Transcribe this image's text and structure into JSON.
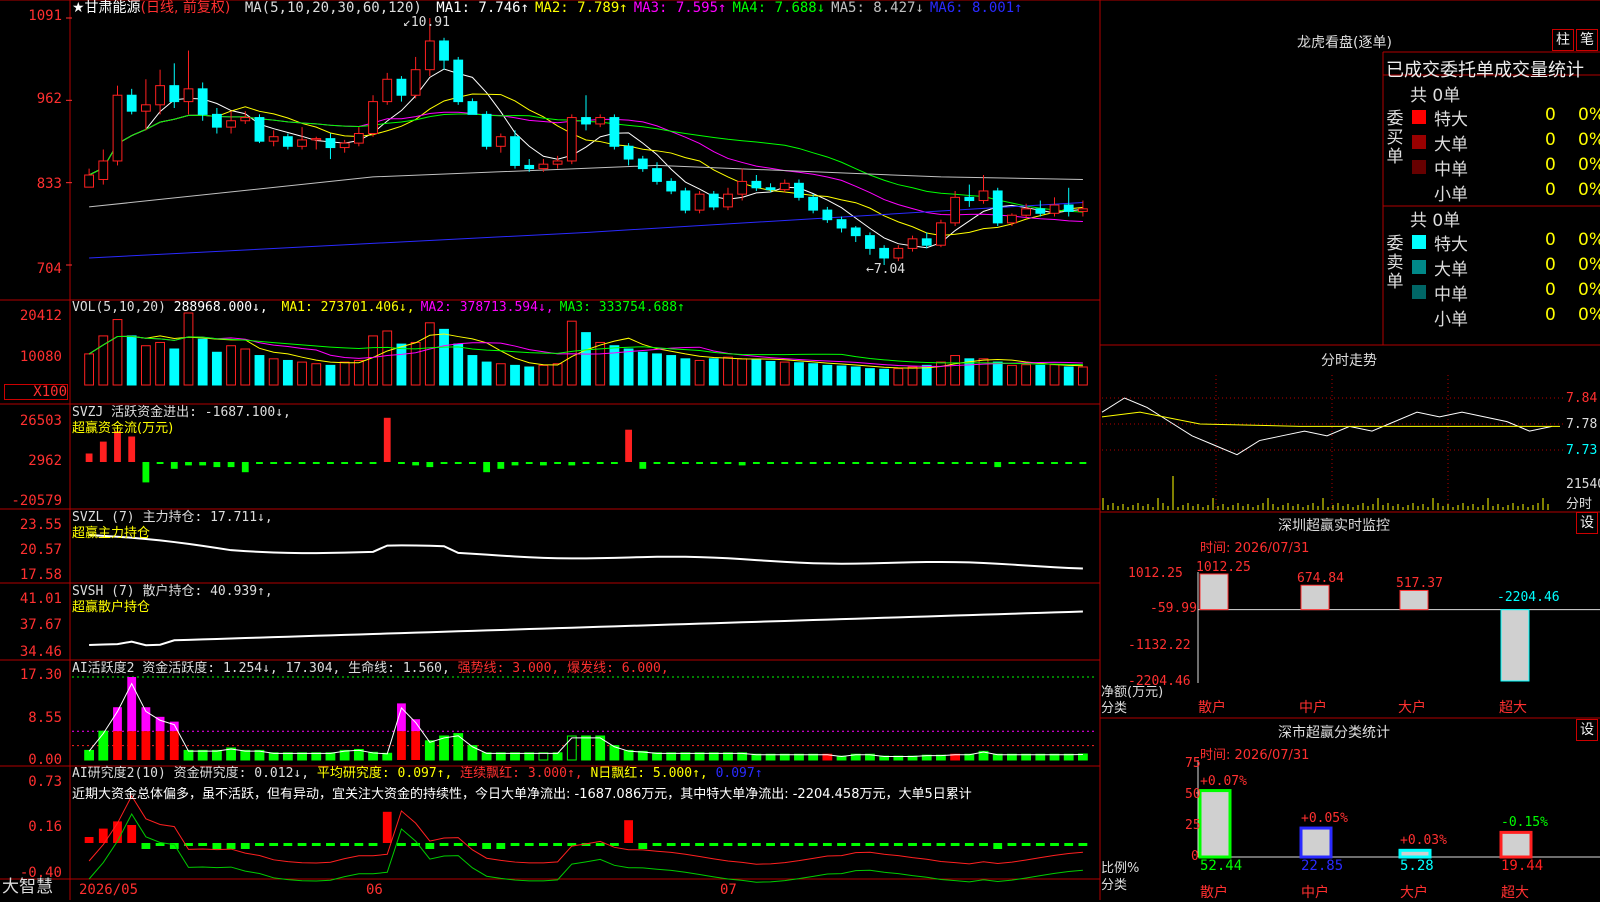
{
  "header": {
    "stock": "★甘肃能源",
    "mode": "(日线, 前复权)",
    "ma_label": "MA(5,10,20,30,60,120)",
    "ma_values": [
      {
        "text": "MA1: 7.746↑",
        "color": "#ffffff"
      },
      {
        "text": "MA2: 7.789↑",
        "color": "#ffff00"
      },
      {
        "text": "MA3: 7.595↑",
        "color": "#ff00ff"
      },
      {
        "text": "MA4: 7.688↓",
        "color": "#00ff00"
      },
      {
        "text": "MA5: 8.427↓",
        "color": "#c0c0c0"
      },
      {
        "text": "MA6: 8.001↑",
        "color": "#2a2aff"
      }
    ],
    "high_mark": "10.91",
    "low_mark": "←7.04"
  },
  "price_axis": [
    "1091",
    "962",
    "833",
    "704"
  ],
  "vol_panel": {
    "title": "VOL(5,10,20)",
    "value": "288968.000↓,",
    "ma": [
      {
        "text": "MA1: 273701.406↓,",
        "color": "#ffff00"
      },
      {
        "text": "MA2: 378713.594↓,",
        "color": "#ff00ff"
      },
      {
        "text": "MA3: 333754.688↑",
        "color": "#00ff00"
      }
    ],
    "axis": [
      "20412",
      "10080",
      "X100"
    ]
  },
  "svzj_panel": {
    "title": "SVZJ  活跃资金进出: -1687.100↓,",
    "subtitle": "超赢资金流(万元)",
    "axis": [
      "26503",
      "2962",
      "-20579"
    ]
  },
  "svzl_panel": {
    "title": "SVZL (7) 主力持仓: 17.711↓,",
    "subtitle": "超赢主力持仓",
    "axis": [
      "23.55",
      "20.57",
      "17.58"
    ]
  },
  "svsh_panel": {
    "title": "SVSH (7) 散户持仓: 40.939↑,",
    "subtitle": "超赢散户持仓",
    "axis": [
      "41.01",
      "37.67",
      "34.46"
    ]
  },
  "active_panel": {
    "title_a": "AI活跃度2 资金活跃度: 1.254↓, 17.304, 生命线: 1.560,",
    "title_b": "强势线: 3.000, 爆发线: 6.000,",
    "axis": [
      "17.30",
      "8.55",
      "0.00"
    ]
  },
  "research_panel": {
    "title_a": "AI研究度2(10) 资金研究度: 0.012↓,",
    "title_b": "平均研究度: 0.097↑,",
    "title_c": "连续飘红: 3.000↑,",
    "title_d": "N日飘红: 5.000↑,",
    "title_e": "0.097↑",
    "comment": "近期大资金总体偏多，虽不活跃，但有异动，宜关注大资金的持续性，今日大单净流出: -1687.086万元，其中特大单净流出: -2204.458万元，大单5日累计",
    "axis": [
      "0.73",
      "0.16",
      "-0.40"
    ]
  },
  "date_axis": [
    "2026/05",
    "06",
    "07"
  ],
  "footer_logo": "大智慧",
  "longhu": {
    "title": "龙虎看盘(逐单)",
    "btn_a": "柱",
    "btn_b": "笔",
    "subtitle": "已成交委托单成交量统计",
    "buy_side": "委买单",
    "sell_side": "委卖单",
    "buy_total": "共 0单",
    "sell_total": "共 0单",
    "buy_rows": [
      {
        "name": "特大",
        "v": "0",
        "p": "0%",
        "color": "#ff0000"
      },
      {
        "name": "大单",
        "v": "0",
        "p": "0%",
        "color": "#990000"
      },
      {
        "name": "中单",
        "v": "0",
        "p": "0%",
        "color": "#660000"
      },
      {
        "name": "小单",
        "v": "0",
        "p": "0%",
        "color": ""
      }
    ],
    "sell_rows": [
      {
        "name": "特大",
        "v": "0",
        "p": "0%",
        "color": "#00ffff"
      },
      {
        "name": "大单",
        "v": "0",
        "p": "0%",
        "color": "#008888"
      },
      {
        "name": "中单",
        "v": "0",
        "p": "0%",
        "color": "#006666"
      },
      {
        "name": "小单",
        "v": "0",
        "p": "0%",
        "color": ""
      }
    ]
  },
  "intraday": {
    "title": "分时走势",
    "axis": [
      "7.84",
      "7.78",
      "7.73"
    ],
    "vol_axis": [
      "21540",
      "分时"
    ]
  },
  "monitor": {
    "title": "深圳超赢实时监控",
    "btn": "设",
    "time": "时间: 2026/07/31",
    "axis": [
      "1012.25",
      "-59.99",
      "-1132.22",
      "-2204.46"
    ],
    "ylabel_a": "净额(万元)",
    "ylabel_b": "分类",
    "categories": [
      "散户",
      "中户",
      "大户",
      "超大"
    ],
    "value_labels": [
      "1012.25",
      "674.84",
      "517.37",
      "-2204.46"
    ]
  },
  "classify": {
    "title": "深市超赢分类统计",
    "btn": "设",
    "time": "时间: 2026/07/31",
    "axis": [
      "75",
      "50",
      "25",
      "0"
    ],
    "ylabel_a": "比例%",
    "ylabel_b": "分类",
    "categories": [
      "散户",
      "中户",
      "大户",
      "超大"
    ],
    "pct_labels": [
      "+0.07%",
      "+0.05%",
      "+0.03%",
      "-0.15%"
    ],
    "share_labels": [
      "52.44",
      "22.85",
      "5.28",
      "19.44"
    ]
  },
  "chart_data": {
    "type": "candlestick",
    "price_ylim": [
      7.04,
      10.91
    ],
    "candles": [
      [
        8.26,
        8.45,
        8.38,
        8.55
      ],
      [
        8.38,
        8.67,
        8.3,
        8.85
      ],
      [
        8.67,
        9.7,
        8.6,
        9.85
      ],
      [
        9.7,
        9.45,
        9.4,
        9.8
      ],
      [
        9.45,
        9.55,
        9.15,
        9.95
      ],
      [
        9.55,
        9.85,
        9.4,
        10.1
      ],
      [
        9.85,
        9.6,
        9.5,
        10.2
      ],
      [
        9.6,
        9.8,
        9.4,
        10.4
      ],
      [
        9.8,
        9.4,
        9.3,
        9.9
      ],
      [
        9.4,
        9.2,
        9.1,
        9.5
      ],
      [
        9.2,
        9.3,
        9.1,
        9.45
      ],
      [
        9.3,
        9.35,
        9.25,
        9.45
      ],
      [
        9.35,
        8.98,
        8.95,
        9.4
      ],
      [
        8.98,
        9.05,
        8.9,
        9.15
      ],
      [
        9.05,
        8.9,
        8.85,
        9.1
      ],
      [
        8.9,
        9.0,
        8.85,
        9.2
      ],
      [
        9.0,
        9.02,
        8.85,
        9.05
      ],
      [
        9.02,
        8.88,
        8.7,
        9.1
      ],
      [
        8.88,
        8.95,
        8.8,
        9.0
      ],
      [
        8.95,
        9.1,
        8.9,
        9.2
      ],
      [
        9.1,
        9.6,
        9.05,
        9.7
      ],
      [
        9.6,
        9.95,
        9.55,
        10.05
      ],
      [
        9.95,
        9.7,
        9.6,
        10.0
      ],
      [
        9.7,
        10.1,
        9.65,
        10.3
      ],
      [
        10.1,
        10.55,
        10.0,
        10.91
      ],
      [
        10.55,
        10.25,
        10.1,
        10.6
      ],
      [
        10.25,
        9.6,
        9.55,
        10.3
      ],
      [
        9.6,
        9.4,
        9.4,
        9.65
      ],
      [
        9.4,
        8.9,
        8.85,
        9.45
      ],
      [
        8.9,
        9.05,
        8.8,
        9.1
      ],
      [
        9.05,
        8.6,
        8.55,
        9.15
      ],
      [
        8.6,
        8.55,
        8.5,
        8.7
      ],
      [
        8.55,
        8.62,
        8.5,
        8.7
      ],
      [
        8.62,
        8.67,
        8.55,
        8.75
      ],
      [
        8.67,
        9.35,
        8.62,
        9.4
      ],
      [
        9.35,
        9.25,
        9.15,
        9.7
      ],
      [
        9.25,
        9.35,
        9.2,
        9.4
      ],
      [
        9.35,
        8.9,
        8.85,
        9.4
      ],
      [
        8.9,
        8.7,
        8.6,
        8.95
      ],
      [
        8.7,
        8.55,
        8.5,
        8.75
      ],
      [
        8.55,
        8.35,
        8.3,
        8.65
      ],
      [
        8.35,
        8.2,
        8.15,
        8.4
      ],
      [
        8.2,
        7.9,
        7.85,
        8.25
      ],
      [
        7.9,
        8.15,
        7.85,
        8.2
      ],
      [
        8.15,
        7.95,
        7.9,
        8.2
      ],
      [
        7.95,
        8.15,
        7.9,
        8.25
      ],
      [
        8.15,
        8.35,
        8.05,
        8.55
      ],
      [
        8.35,
        8.25,
        8.2,
        8.45
      ],
      [
        8.25,
        8.22,
        8.18,
        8.32
      ],
      [
        8.22,
        8.32,
        8.18,
        8.38
      ],
      [
        8.32,
        8.1,
        8.05,
        8.38
      ],
      [
        8.1,
        7.9,
        7.85,
        8.15
      ],
      [
        7.9,
        7.75,
        7.7,
        7.95
      ],
      [
        7.75,
        7.62,
        7.55,
        7.8
      ],
      [
        7.62,
        7.5,
        7.4,
        7.65
      ],
      [
        7.5,
        7.3,
        7.2,
        7.55
      ],
      [
        7.3,
        7.15,
        7.04,
        7.35
      ],
      [
        7.15,
        7.3,
        7.1,
        7.35
      ],
      [
        7.3,
        7.45,
        7.25,
        7.5
      ],
      [
        7.45,
        7.35,
        7.3,
        7.55
      ],
      [
        7.35,
        7.7,
        7.32,
        7.75
      ],
      [
        7.7,
        8.1,
        7.65,
        8.2
      ],
      [
        8.1,
        8.05,
        7.95,
        8.3
      ],
      [
        8.05,
        8.2,
        8.0,
        8.45
      ],
      [
        8.2,
        7.7,
        7.65,
        8.25
      ],
      [
        7.7,
        7.82,
        7.65,
        7.85
      ],
      [
        7.82,
        7.92,
        7.78,
        8.0
      ],
      [
        7.92,
        7.85,
        7.8,
        8.05
      ],
      [
        7.85,
        7.98,
        7.8,
        8.1
      ],
      [
        7.98,
        7.88,
        7.8,
        8.25
      ],
      [
        7.88,
        7.92,
        7.8,
        8.05
      ]
    ],
    "volume": [
      95,
      150,
      200,
      150,
      120,
      130,
      110,
      220,
      140,
      100,
      120,
      110,
      90,
      80,
      75,
      70,
      65,
      60,
      70,
      75,
      150,
      165,
      125,
      130,
      190,
      170,
      125,
      90,
      70,
      65,
      60,
      55,
      60,
      65,
      195,
      160,
      130,
      120,
      110,
      100,
      95,
      90,
      80,
      75,
      80,
      85,
      80,
      78,
      72,
      70,
      68,
      65,
      60,
      58,
      55,
      50,
      48,
      50,
      55,
      60,
      70,
      90,
      80,
      80,
      70,
      60,
      62,
      60,
      62,
      55,
      55
    ],
    "vol_ylim": [
      0,
      20412
    ],
    "money_flow": [
      5,
      12,
      18,
      15,
      -12,
      -1,
      -4,
      -2,
      -2,
      -3,
      -3,
      -6,
      -1,
      -1,
      -1,
      -1,
      -1,
      -1,
      -1,
      -1,
      -1,
      26,
      -1,
      -2,
      -3,
      -1,
      -1,
      -1,
      -6,
      -4,
      -2,
      -1,
      -2,
      -1,
      -2,
      -1,
      -1,
      -1,
      19,
      -4,
      -1,
      -1,
      -1,
      -1,
      -1,
      -1,
      -2,
      -1,
      -1,
      -1,
      -1,
      -1,
      -1,
      -1,
      -1,
      -1,
      -1,
      -1,
      -1,
      -1,
      -1,
      -1,
      -1,
      -1,
      -3,
      -1,
      -1,
      -1,
      -1,
      -1,
      -1
    ],
    "money_flow_ylim": [
      -20579,
      26503
    ],
    "main_holding_ylim": [
      17.58,
      23.55
    ],
    "retail_holding_ylim": [
      34.46,
      41.01
    ],
    "activity": [
      2,
      6,
      11,
      17.3,
      11,
      9,
      8,
      2,
      2,
      2,
      2.5,
      2,
      2,
      1.5,
      1.5,
      1.5,
      1.5,
      1.5,
      2,
      2.2,
      1.6,
      1.4,
      11.8,
      8.5,
      4,
      5,
      5.5,
      3,
      1.5,
      1.5,
      1.5,
      1.5,
      1.5,
      1.5,
      5,
      5,
      5,
      3,
      2,
      1.8,
      1.5,
      1.5,
      1.5,
      1.5,
      1.5,
      1.5,
      1.5,
      1.2,
      1.2,
      1.2,
      1.2,
      1.2,
      1.2,
      0.8,
      1.2,
      1.2,
      0.8,
      0.8,
      0.8,
      1.0,
      1.0,
      1.2,
      1.2,
      1.8,
      1.2,
      1.2,
      1.2,
      1.2,
      1.2,
      1.2,
      1.254
    ],
    "activity_ylim": [
      0,
      17.3
    ],
    "strong_line": 3.0,
    "burst_line": 6.0,
    "research_ylim": [
      -0.4,
      0.73
    ],
    "monitor_values": [
      1012.25,
      674.84,
      517.37,
      -2204.46
    ],
    "monitor_ylim": [
      -2204.46,
      1012.25
    ],
    "classify_share": [
      52.44,
      22.85,
      5.28,
      19.44
    ],
    "classify_change": [
      0.07,
      0.05,
      0.03,
      -0.15
    ],
    "classify_ylim": [
      0,
      75
    ],
    "intraday_ylim": [
      7.73,
      7.84
    ]
  }
}
